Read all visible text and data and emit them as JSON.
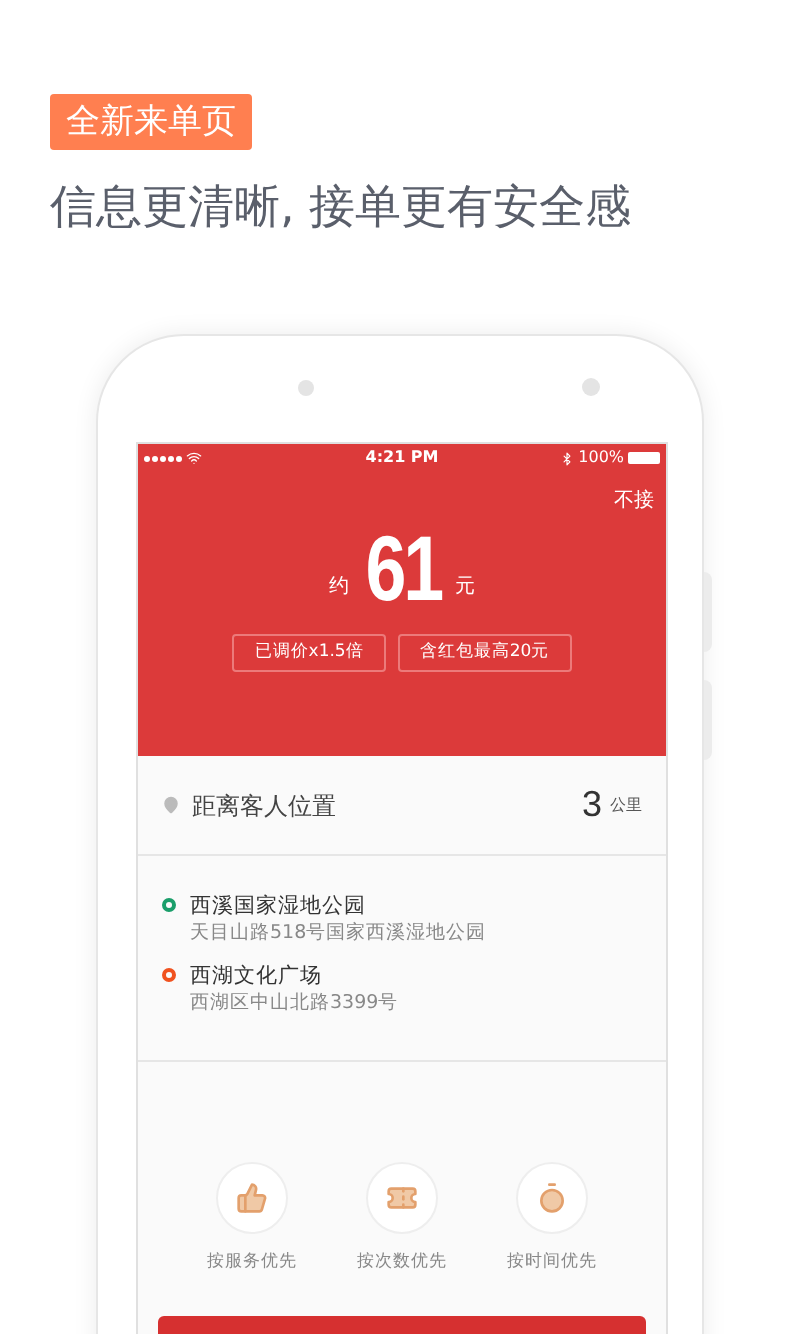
{
  "header": {
    "badge": "全新来单页",
    "tagline": "信息更清晰, 接单更有安全感"
  },
  "status_bar": {
    "time": "4:21 PM",
    "battery": "100%"
  },
  "order": {
    "skip_button": "不接",
    "price_prefix": "约",
    "price": "61",
    "price_unit": "元",
    "tags": [
      "已调价x1.5倍",
      "含红包最高20元"
    ]
  },
  "distance": {
    "label": "距离客人位置",
    "value": "3",
    "unit": "公里"
  },
  "addresses": [
    {
      "name": "西溪国家湿地公园",
      "detail": "天目山路518号国家西溪湿地公园",
      "color": "#1a9e6a"
    },
    {
      "name": "西湖文化广场",
      "detail": "西湖区中山北路3399号",
      "color": "#f0521f"
    }
  ],
  "priorities": [
    {
      "kind": "thumbs",
      "label": "按服务优先"
    },
    {
      "kind": "ticket",
      "label": "按次数优先"
    },
    {
      "kind": "timer",
      "label": "按时间优先"
    }
  ]
}
